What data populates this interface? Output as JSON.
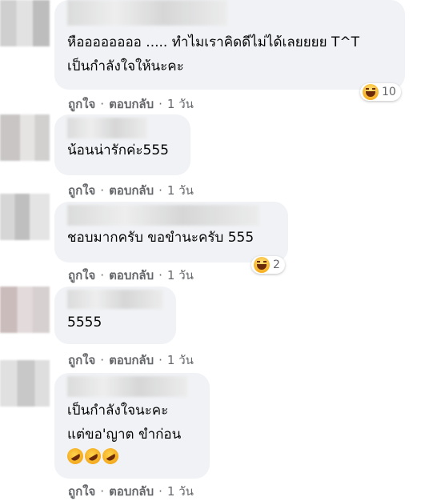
{
  "comments": [
    {
      "lines": [
        "หืออออออออ ..... ทำไมเราคิดดีไม่ได้เลยยยย T^T",
        "เป็นกำลังใจให้นะคะ"
      ],
      "reaction": {
        "icon": "haha-icon",
        "count": "10"
      },
      "like_label": "ถูกใจ",
      "reply_label": "ตอบกลับ",
      "time": "1 วัน"
    },
    {
      "lines": [
        "น้อนน่ารักค่ะ555"
      ],
      "like_label": "ถูกใจ",
      "reply_label": "ตอบกลับ",
      "time": "1 วัน"
    },
    {
      "lines": [
        "ชอบมากครับ ขอขำนะครับ 555"
      ],
      "reaction": {
        "icon": "haha-icon",
        "count": "2"
      },
      "like_label": "ถูกใจ",
      "reply_label": "ตอบกลับ",
      "time": "1 วัน"
    },
    {
      "lines": [
        "5555"
      ],
      "like_label": "ถูกใจ",
      "reply_label": "ตอบกลับ",
      "time": "1 วัน"
    },
    {
      "lines": [
        "เป็นกำลังใจนะคะ",
        "แต่ขอ'ญาต ขำก่อน"
      ],
      "emojis": [
        "rolling-on-floor-laughing-icon",
        "rolling-on-floor-laughing-icon",
        "rolling-on-floor-laughing-icon"
      ],
      "like_label": "ถูกใจ",
      "reply_label": "ตอบกลับ",
      "time": "1 วัน"
    }
  ],
  "separator": "·"
}
